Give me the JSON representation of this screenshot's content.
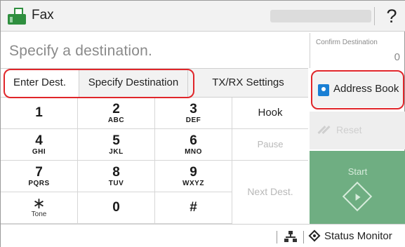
{
  "header": {
    "title": "Fax",
    "help_label": "?"
  },
  "destination": {
    "placeholder": "Specify a destination.",
    "confirm_label": "Confirm Destination",
    "confirm_count": "0"
  },
  "tabs": [
    {
      "label": "Enter Dest.",
      "selected": true
    },
    {
      "label": "Specify Destination",
      "selected": false
    },
    {
      "label": "TX/RX Settings",
      "selected": false
    }
  ],
  "address_book": {
    "label": "Address Book",
    "icon": "address-book-icon"
  },
  "keypad": [
    {
      "digit": "1",
      "letters": ""
    },
    {
      "digit": "2",
      "letters": "ABC"
    },
    {
      "digit": "3",
      "letters": "DEF"
    },
    {
      "digit": "4",
      "letters": "GHI"
    },
    {
      "digit": "5",
      "letters": "JKL"
    },
    {
      "digit": "6",
      "letters": "MNO"
    },
    {
      "digit": "7",
      "letters": "PQRS"
    },
    {
      "digit": "8",
      "letters": "TUV"
    },
    {
      "digit": "9",
      "letters": "WXYZ"
    },
    {
      "digit": "∗",
      "letters": "Tone"
    },
    {
      "digit": "0",
      "letters": ""
    },
    {
      "digit": "#",
      "letters": ""
    }
  ],
  "functions": {
    "hook": "Hook",
    "pause": "Pause",
    "next_dest": "Next Dest."
  },
  "controls": {
    "reset": "Reset",
    "start": "Start"
  },
  "status_bar": {
    "status_monitor": "Status Monitor"
  },
  "colors": {
    "highlight": "#e0262a",
    "start_green": "#6fae82",
    "fax_green": "#2f8f3f",
    "address_blue": "#1a7fd4"
  }
}
